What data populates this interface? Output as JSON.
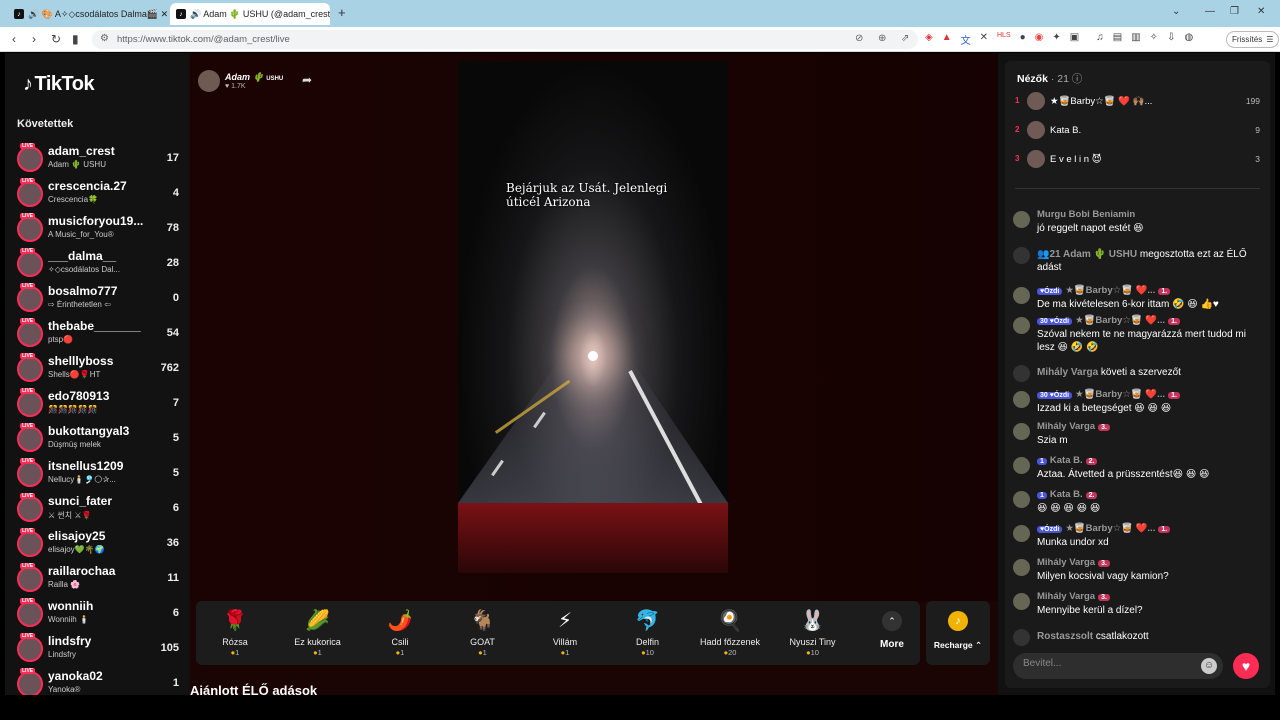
{
  "browser": {
    "tabs": [
      {
        "label": "🔊 🎨 A✧◇csodálatos Dalma🎬 ✕"
      },
      {
        "label": "🔊 Adam 🌵 USHU (@adam_crest"
      }
    ],
    "url": "https://www.tiktok.com/@adam_crest/live",
    "update_label": "Frissítés"
  },
  "sidebar": {
    "logo": "TikTok",
    "following_title": "Követettek",
    "items": [
      {
        "name": "adam_crest",
        "sub": "Adam 🌵 USHU",
        "count": "17"
      },
      {
        "name": "crescencia.27",
        "sub": "Crescencia🍀",
        "count": "4"
      },
      {
        "name": "musicforyou19...",
        "sub": "A Music_for_You®",
        "count": "78"
      },
      {
        "name": "___dalma__",
        "sub": "✧◇csodálatos Dal...",
        "count": "28"
      },
      {
        "name": "bosalmo777",
        "sub": "⇨ Érinthetetlen ⇦",
        "count": "0"
      },
      {
        "name": "thebabe_______",
        "sub": "ptsp🔴",
        "count": "54"
      },
      {
        "name": "shelllyboss",
        "sub": "Shells🔴🌹HT",
        "count": "762"
      },
      {
        "name": "edo780913",
        "sub": "🎊🎊🎊🎊🎊",
        "count": "7"
      },
      {
        "name": "bukottangyal3",
        "sub": "Düşmüş melek",
        "count": "5"
      },
      {
        "name": "itsnellus1209",
        "sub": "Nellucy🕯️🎐🌕✰...",
        "count": "5"
      },
      {
        "name": "sunci_fater",
        "sub": "⚔ 썬치 ⚔🌹",
        "count": "6"
      },
      {
        "name": "elisajoy25",
        "sub": "elisajoy💚🌴🌍",
        "count": "36"
      },
      {
        "name": "raillarochaa",
        "sub": "Railla 🌸",
        "count": "11"
      },
      {
        "name": "wonniih",
        "sub": "Wonniih 🕯️",
        "count": "6"
      },
      {
        "name": "lindsfry",
        "sub": "Lindsfry",
        "count": "105"
      },
      {
        "name": "yanoka02",
        "sub": "Yanoka®",
        "count": "1"
      }
    ]
  },
  "stage": {
    "host_name": "Adam 🌵",
    "host_tag": "USHU",
    "host_likes": "♥ 1.7K",
    "caption": "Bejárjuk az Usát. Jelenlegi úticél Arizona",
    "gifts": [
      {
        "icon": "🌹",
        "name": "Rózsa",
        "price": "1"
      },
      {
        "icon": "🌽",
        "name": "Ez kukorica",
        "price": "1"
      },
      {
        "icon": "🌶️",
        "name": "Csili",
        "price": "1"
      },
      {
        "icon": "🐐",
        "name": "GOAT",
        "price": "1"
      },
      {
        "icon": "⚡",
        "name": "Villám",
        "price": "1"
      },
      {
        "icon": "🐬",
        "name": "Delfin",
        "price": "10"
      },
      {
        "icon": "🍳",
        "name": "Hadd főzzenek",
        "price": "20"
      },
      {
        "icon": "🐰",
        "name": "Nyuszi Tiny",
        "price": "10"
      }
    ],
    "more_label": "More",
    "recharge_label": "Recharge ⌃",
    "recommended_title": "Ajánlott ÉLŐ adások"
  },
  "chat": {
    "viewers_title": "Nézők",
    "viewers_count": "· 21",
    "top_viewers": [
      {
        "rank": "1",
        "name": "★🥃Barby☆🥃 ❤️ 🙌🏽...",
        "score": "199"
      },
      {
        "rank": "2",
        "name": "Kata B.",
        "score": "9"
      },
      {
        "rank": "3",
        "name": "E v e l i n 😈",
        "score": "3"
      }
    ],
    "messages": [
      {
        "type": "comment",
        "user": "Murgu Bobi Beniamin",
        "level": "",
        "fan": "",
        "text": "jó reggelt napot estét 😆"
      },
      {
        "type": "info",
        "user": "👥21 Adam 🌵 USHU",
        "text": "megosztotta ezt az ÉLŐ adást"
      },
      {
        "type": "comment",
        "user": "★🥃Barby☆🥃 ❤️...",
        "level": "♥Ózdi",
        "fan": "1.",
        "text": "De ma kivételesen 6-kor ittam 🤣 😆 👍♥"
      },
      {
        "type": "comment",
        "user": "★🥃Barby☆🥃 ❤️...",
        "level": "30 ♥Ózdi",
        "fan": "1.",
        "text": "Szóval nekem te ne magyarázzá mert tudod mi lesz 😆 🤣 🤣"
      },
      {
        "type": "info",
        "user": "Mihály Varga",
        "text": "követi a szervezőt"
      },
      {
        "type": "comment",
        "user": "★🥃Barby☆🥃 ❤️...",
        "level": "30 ♥Ózdi",
        "fan": "1.",
        "text": "Izzad ki a betegséget 😆 😆 😆"
      },
      {
        "type": "comment",
        "user": "Mihály Varga",
        "level": "",
        "fan": "3.",
        "text": "Szia m"
      },
      {
        "type": "comment",
        "user": "Kata B.",
        "level": "1",
        "fan": "2.",
        "text": "Aztaa. Átvetted a prüsszentést😆 😆 😆"
      },
      {
        "type": "comment",
        "user": "Kata B.",
        "level": "1",
        "fan": "2.",
        "text": "😆 😆 😆 😆 😆"
      },
      {
        "type": "comment",
        "user": "★🥃Barby☆🥃 ❤️...",
        "level": "♥Ózdi",
        "fan": "1.",
        "text": "Munka undor xd"
      },
      {
        "type": "comment",
        "user": "Mihály Varga",
        "level": "",
        "fan": "3.",
        "text": "Milyen kocsival vagy kamion?"
      },
      {
        "type": "comment",
        "user": "Mihály Varga",
        "level": "",
        "fan": "3.",
        "text": "Mennyibe kerül a dízel?"
      },
      {
        "type": "info",
        "user": "Rostaszsolt",
        "text": "csatlakozott"
      }
    ],
    "input_placeholder": "Bevitel...",
    "colors": {
      "accent": "#fe2c55",
      "coin": "#f5b800"
    }
  }
}
